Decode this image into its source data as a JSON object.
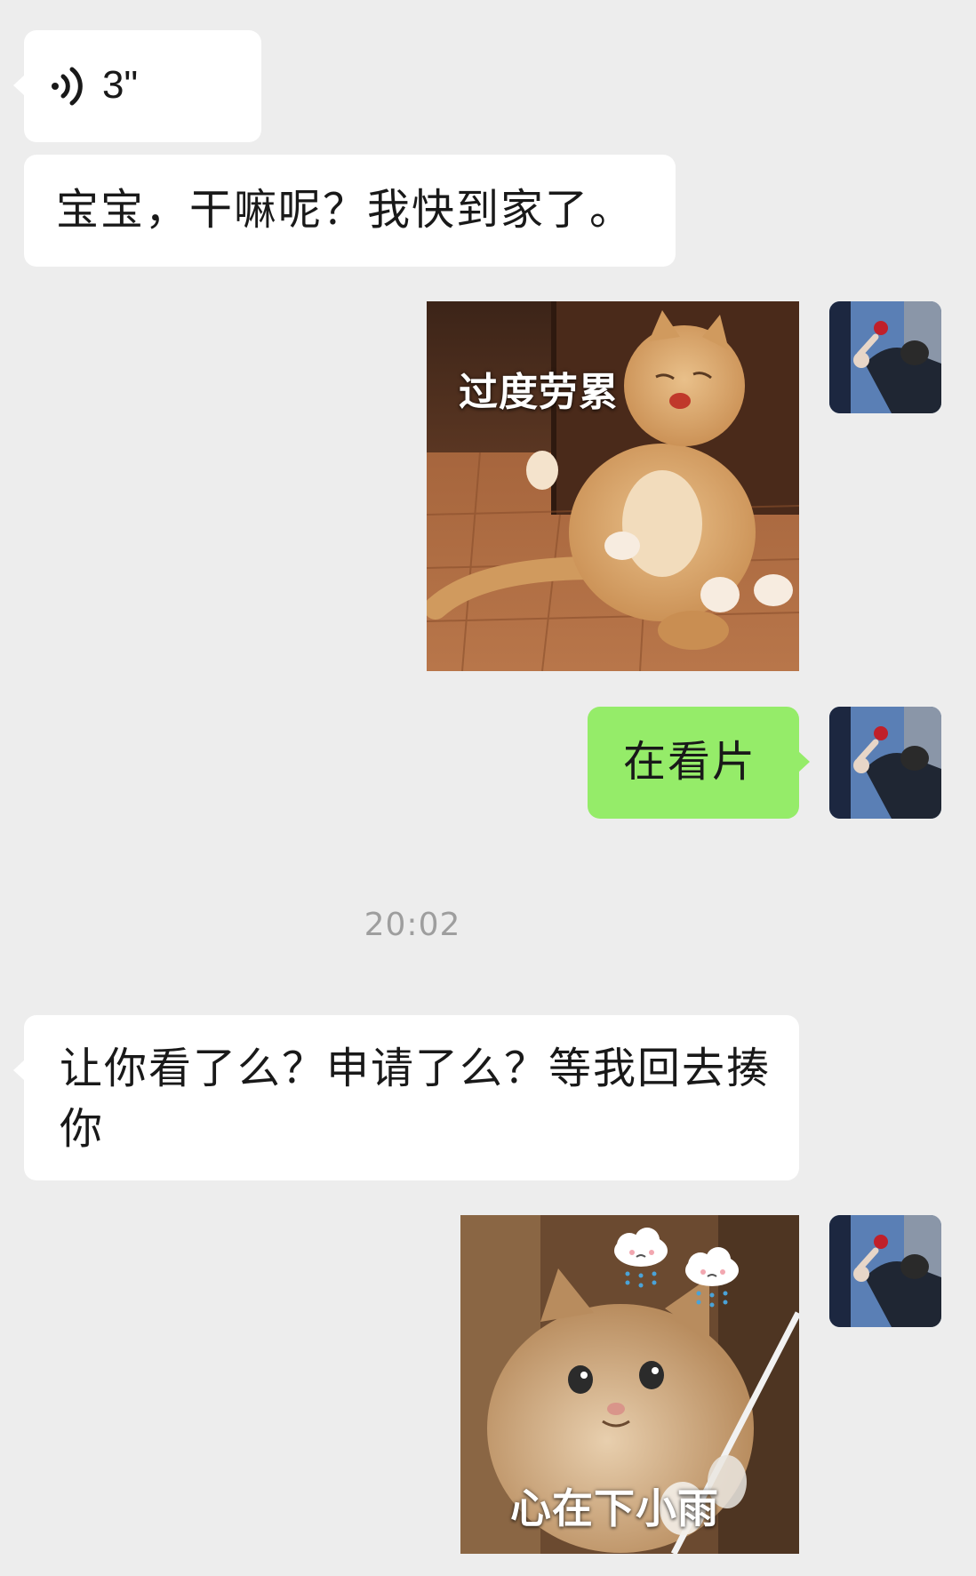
{
  "chat": {
    "messages": [
      {
        "id": "m1",
        "sender": "other",
        "type": "voice",
        "duration": "3\""
      },
      {
        "id": "m2",
        "sender": "other",
        "type": "text",
        "text": "宝宝，干嘛呢？我快到家了。"
      },
      {
        "id": "m3",
        "sender": "self",
        "type": "sticker",
        "caption": "过度劳累"
      },
      {
        "id": "m4",
        "sender": "self",
        "type": "text",
        "text": "在看片"
      },
      {
        "id": "m5",
        "type": "timestamp",
        "text": "20:02"
      },
      {
        "id": "m6",
        "sender": "other",
        "type": "text",
        "text": "让你看了么？申请了么？等我回去揍你"
      },
      {
        "id": "m7",
        "sender": "self",
        "type": "sticker",
        "caption": "心在下小雨"
      }
    ]
  },
  "colors": {
    "background": "#ededed",
    "incoming_bubble": "#ffffff",
    "outgoing_bubble": "#95ec69",
    "timestamp_text": "#9e9e9e"
  },
  "icons": {
    "voice": "voice-wave-icon",
    "rain_cloud": "rain-cloud-icon"
  }
}
